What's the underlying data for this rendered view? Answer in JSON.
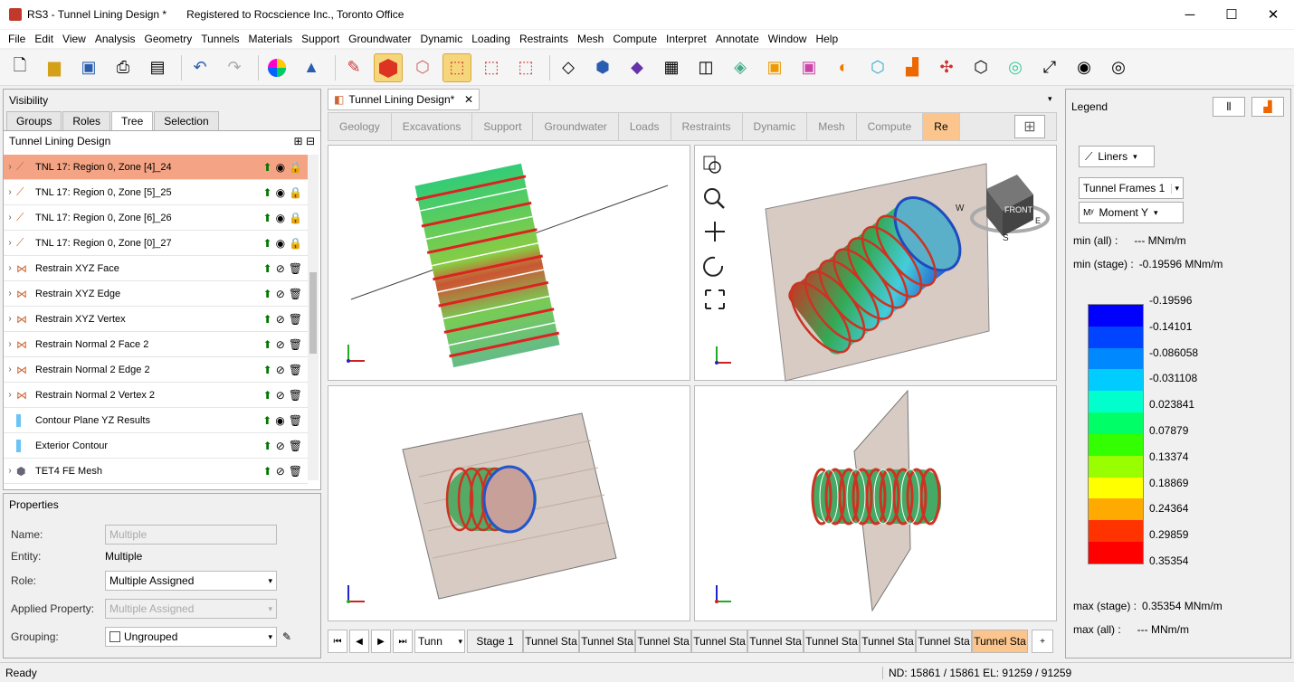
{
  "title": {
    "app": "RS3 - Tunnel Lining Design *",
    "registration": "Registered to Rocscience Inc., Toronto Office"
  },
  "window_buttons": [
    "─",
    "☐",
    "✕"
  ],
  "menu": [
    "File",
    "Edit",
    "View",
    "Analysis",
    "Geometry",
    "Tunnels",
    "Materials",
    "Support",
    "Groundwater",
    "Dynamic",
    "Loading",
    "Restraints",
    "Mesh",
    "Compute",
    "Interpret",
    "Annotate",
    "Window",
    "Help"
  ],
  "visibility": {
    "title": "Visibility",
    "tabs": [
      "Groups",
      "Roles",
      "Tree",
      "Selection"
    ],
    "tree_title": "Tunnel Lining Design",
    "items": [
      {
        "label": "TNL 17: Region 0, Zone [4]_24"
      },
      {
        "label": "TNL 17: Region 0, Zone [5]_25"
      },
      {
        "label": "TNL 17: Region 0, Zone [6]_26"
      },
      {
        "label": "TNL 17: Region 0, Zone [0]_27"
      },
      {
        "label": "Restrain XYZ Face"
      },
      {
        "label": "Restrain XYZ Edge"
      },
      {
        "label": "Restrain XYZ Vertex"
      },
      {
        "label": "Restrain Normal 2 Face 2"
      },
      {
        "label": "Restrain Normal 2 Edge 2"
      },
      {
        "label": "Restrain Normal 2 Vertex 2"
      },
      {
        "label": "Contour Plane YZ Results"
      },
      {
        "label": "Exterior Contour"
      },
      {
        "label": "TET4 FE Mesh"
      }
    ]
  },
  "properties": {
    "title": "Properties",
    "name_label": "Name:",
    "name_value": "Multiple",
    "entity_label": "Entity:",
    "entity_value": "Multiple",
    "role_label": "Role:",
    "role_value": "Multiple Assigned",
    "applied_label": "Applied Property:",
    "applied_value": "Multiple Assigned",
    "grouping_label": "Grouping:",
    "grouping_value": "Ungrouped"
  },
  "document_tab": "Tunnel Lining Design*",
  "workflow": [
    "Geology",
    "Excavations",
    "Support",
    "Groundwater",
    "Loads",
    "Restraints",
    "Dynamic",
    "Mesh",
    "Compute",
    "Re"
  ],
  "stages": {
    "dropdown": "Tunn",
    "items": [
      "Stage 1",
      "Tunnel Sta",
      "Tunnel Sta",
      "Tunnel Sta",
      "Tunnel Sta",
      "Tunnel Sta",
      "Tunnel Sta",
      "Tunnel Sta",
      "Tunnel Sta",
      "Tunnel Sta"
    ],
    "add": "+"
  },
  "legend": {
    "title": "Legend",
    "liners_btn": "Liners",
    "frames": "Tunnel Frames 1",
    "moment": "Moment Y",
    "min_all_label": "min (all) :",
    "min_all_value": "--- MNm/m",
    "min_stage_label": "min (stage) :",
    "min_stage_value": "-0.19596 MNm/m",
    "values": [
      "-0.19596",
      "-0.14101",
      "-0.086058",
      "-0.031108",
      "0.023841",
      "0.07879",
      "0.13374",
      "0.18869",
      "0.24364",
      "0.29859",
      "0.35354"
    ],
    "colors": [
      "#0000ff",
      "#0044ff",
      "#0088ff",
      "#00ccff",
      "#00ffcc",
      "#00ff66",
      "#33ff00",
      "#99ff00",
      "#ffff00",
      "#ffaa00",
      "#ff3300",
      "#ff0000"
    ],
    "max_stage_label": "max (stage) :",
    "max_stage_value": "0.35354 MNm/m",
    "max_all_label": "max (all) :",
    "max_all_value": "--- MNm/m"
  },
  "viewcube": {
    "face": "FRONT",
    "w": "W",
    "s": "S",
    "e": "E"
  },
  "status": {
    "left": "Ready",
    "right": "ND: 15861 / 15861  EL: 91259 / 91259"
  }
}
